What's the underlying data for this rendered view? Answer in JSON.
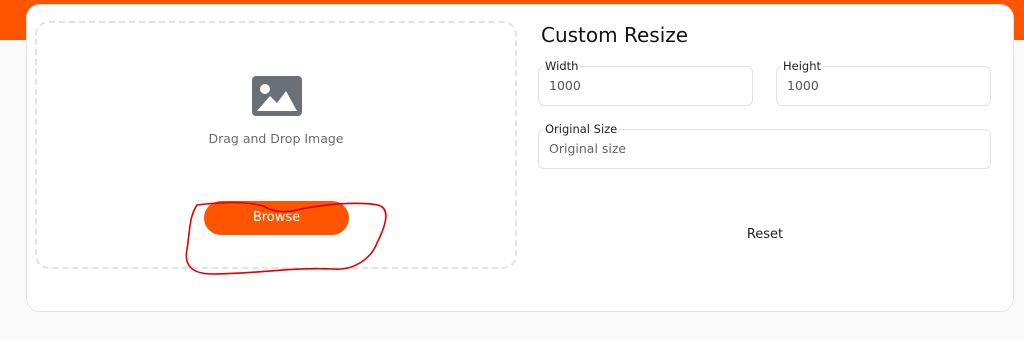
{
  "dropzone": {
    "icon": "image-icon",
    "text": "Drag and Drop Image",
    "browse_label": "Browse"
  },
  "resize": {
    "title": "Custom Resize",
    "width": {
      "label": "Width",
      "value": "1000"
    },
    "height": {
      "label": "Height",
      "value": "1000"
    },
    "original_size": {
      "label": "Original Size",
      "placeholder": "Original size"
    },
    "reset_label": "Reset"
  },
  "colors": {
    "accent": "#ff5400",
    "annotation": "#e00000",
    "icon": "#6b6f76"
  }
}
